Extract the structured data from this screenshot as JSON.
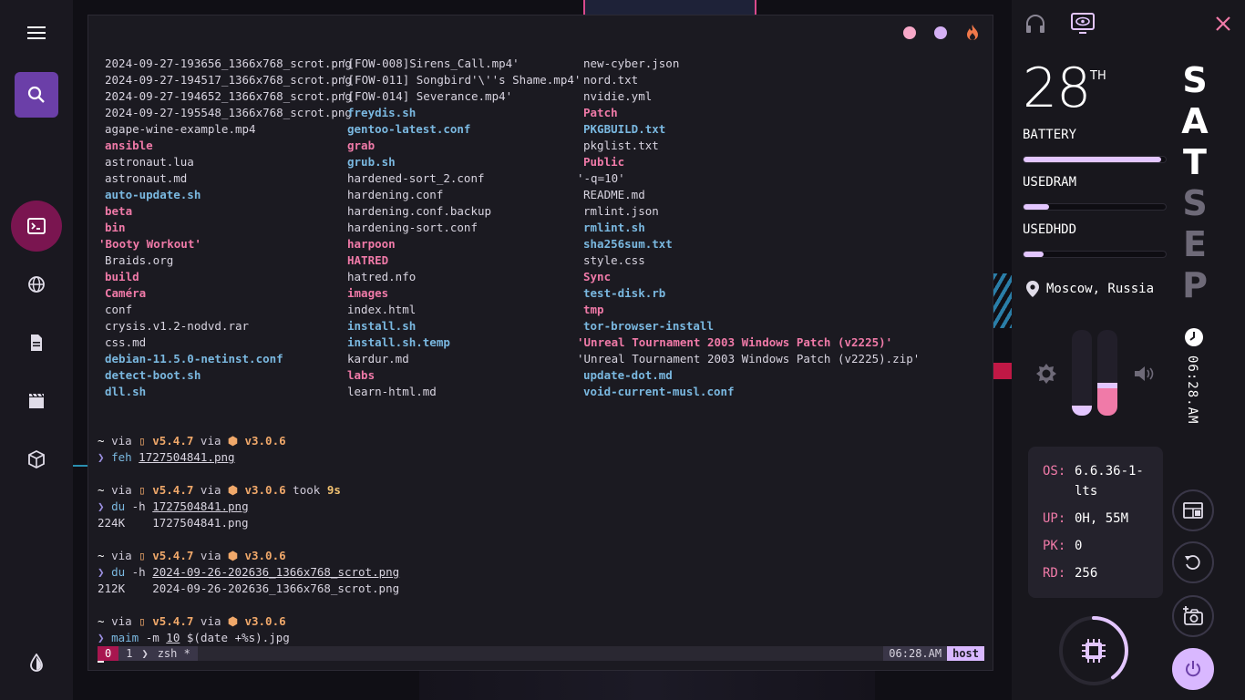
{
  "dock": {
    "items": [
      {
        "name": "menu-icon"
      },
      {
        "name": "search-icon"
      },
      {
        "name": "terminal-icon"
      },
      {
        "name": "globe-icon"
      },
      {
        "name": "document-icon"
      },
      {
        "name": "video-icon"
      },
      {
        "name": "package-icon"
      },
      {
        "name": "contrast-icon"
      }
    ]
  },
  "terminal": {
    "ls": {
      "col1": [
        {
          "t": "2024-09-27-193656_1366x768_scrot.png",
          "k": "file"
        },
        {
          "t": "2024-09-27-194517_1366x768_scrot.png",
          "k": "file"
        },
        {
          "t": "2024-09-27-194652_1366x768_scrot.png",
          "k": "file"
        },
        {
          "t": "2024-09-27-195548_1366x768_scrot.png",
          "k": "file"
        },
        {
          "t": "agape-wine-example.mp4",
          "k": "file"
        },
        {
          "t": "ansible",
          "k": "dir"
        },
        {
          "t": "astronaut.lua",
          "k": "file"
        },
        {
          "t": "astronaut.md",
          "k": "file"
        },
        {
          "t": "auto-update.sh",
          "k": "exec"
        },
        {
          "t": "beta",
          "k": "dir"
        },
        {
          "t": "bin",
          "k": "dir"
        },
        {
          "t": "'Booty Workout'",
          "k": "qdir"
        },
        {
          "t": "Braids.org",
          "k": "file"
        },
        {
          "t": "build",
          "k": "dir"
        },
        {
          "t": "Caméra",
          "k": "dir"
        },
        {
          "t": "conf",
          "k": "file"
        },
        {
          "t": "crysis.v1.2-nodvd.rar",
          "k": "file"
        },
        {
          "t": "css.md",
          "k": "file"
        },
        {
          "t": "debian-11.5.0-netinst.conf",
          "k": "exec"
        },
        {
          "t": "detect-boot.sh",
          "k": "exec"
        },
        {
          "t": "dll.sh",
          "k": "exec"
        }
      ],
      "col2": [
        {
          "t": "'[FOW-008]Sirens_Call.mp4'",
          "k": "q"
        },
        {
          "t": "'[FOW-011] Songbird'\\''s Shame.mp4'",
          "k": "q"
        },
        {
          "t": "'[FOW-014] Severance.mp4'",
          "k": "q"
        },
        {
          "t": "freydis.sh",
          "k": "exec"
        },
        {
          "t": "gentoo-latest.conf",
          "k": "exec"
        },
        {
          "t": "grab",
          "k": "dir"
        },
        {
          "t": "grub.sh",
          "k": "exec"
        },
        {
          "t": "hardened-sort_2.conf",
          "k": "file"
        },
        {
          "t": "hardening.conf",
          "k": "file"
        },
        {
          "t": "hardening.conf.backup",
          "k": "file"
        },
        {
          "t": "hardening-sort.conf",
          "k": "file"
        },
        {
          "t": "harpoon",
          "k": "dir"
        },
        {
          "t": "HATRED",
          "k": "dir"
        },
        {
          "t": "hatred.nfo",
          "k": "file"
        },
        {
          "t": "images",
          "k": "dir"
        },
        {
          "t": "index.html",
          "k": "file"
        },
        {
          "t": "install.sh",
          "k": "exec"
        },
        {
          "t": "install.sh.temp",
          "k": "exec"
        },
        {
          "t": "kardur.md",
          "k": "file"
        },
        {
          "t": "labs",
          "k": "dir"
        },
        {
          "t": "learn-html.md",
          "k": "file"
        }
      ],
      "col3": [
        {
          "t": "new-cyber.json",
          "k": "file"
        },
        {
          "t": "nord.txt",
          "k": "file"
        },
        {
          "t": "nvidie.yml",
          "k": "file"
        },
        {
          "t": "Patch",
          "k": "dir"
        },
        {
          "t": "PKGBUILD.txt",
          "k": "exec"
        },
        {
          "t": "pkglist.txt",
          "k": "file"
        },
        {
          "t": "Public",
          "k": "dir"
        },
        {
          "t": "'-q=10'",
          "k": "q"
        },
        {
          "t": "README.md",
          "k": "file"
        },
        {
          "t": "rmlint.json",
          "k": "file"
        },
        {
          "t": "rmlint.sh",
          "k": "exec"
        },
        {
          "t": "sha256sum.txt",
          "k": "exec"
        },
        {
          "t": "style.css",
          "k": "file"
        },
        {
          "t": "Sync",
          "k": "dir"
        },
        {
          "t": "test-disk.rb",
          "k": "exec"
        },
        {
          "t": "tmp",
          "k": "dir"
        },
        {
          "t": "tor-browser-install",
          "k": "exec"
        },
        {
          "t": "'Unreal Tournament 2003 Windows Patch (v2225)'",
          "k": "qdir"
        },
        {
          "t": "'Unreal Tournament 2003 Windows Patch (v2225).zip'",
          "k": "q"
        },
        {
          "t": "update-dot.md",
          "k": "exec"
        },
        {
          "t": "void-current-musl.conf",
          "k": "exec"
        }
      ]
    },
    "prompts": [
      {
        "ver1": "v5.4.7",
        "ver2": "v3.0.6",
        "took": "",
        "cmd": "feh",
        "flag": "",
        "arg": "1727504841.png",
        "out": ""
      },
      {
        "ver1": "v5.4.7",
        "ver2": "v3.0.6",
        "took": "9s",
        "cmd": "du",
        "flag": "-h",
        "arg": "1727504841.png",
        "out": "224K    1727504841.png"
      },
      {
        "ver1": "v5.4.7",
        "ver2": "v3.0.6",
        "took": "",
        "cmd": "du",
        "flag": "-h",
        "arg": "2024-09-26-202636_1366x768_scrot.png",
        "out": "212K    2024-09-26-202636_1366x768_scrot.png"
      },
      {
        "ver1": "v5.4.7",
        "ver2": "v3.0.6",
        "took": "",
        "cmd": "maim",
        "flag": "-m",
        "arg": "10",
        "rest": "$(date +%s).jpg",
        "out": ""
      }
    ],
    "prompt_tilde": "~",
    "prompt_via": "via",
    "prompt_took": "took",
    "status": {
      "session": "0",
      "window": "1",
      "shell": "zsh *",
      "time": "06:28.AM",
      "host": "host"
    }
  },
  "panel": {
    "day": "28",
    "day_suffix": "TH",
    "battery_label": "BATTERY",
    "battery_level": 0.97,
    "ram_label": "USEDRAM",
    "ram_level": 0.18,
    "hdd_label": "USEDHDD",
    "hdd_level": 0.14,
    "location": "Moscow, Russia",
    "month_letters": [
      "S",
      "A",
      "T",
      "S",
      "E",
      "P"
    ],
    "clock": "06:28.AM",
    "brightness_level": 0.12,
    "volume_level": 0.32,
    "sysinfo": [
      {
        "k": "OS:",
        "v": "6.6.36-1-lts"
      },
      {
        "k": "UP:",
        "v": "0H, 55M"
      },
      {
        "k": "PK:",
        "v": "0"
      },
      {
        "k": "RD:",
        "v": "256"
      }
    ],
    "cpu_level": 0.4,
    "colors": {
      "accent": "#e3c6ff",
      "pink": "#f07aa8",
      "magenta": "#a8164f"
    }
  }
}
